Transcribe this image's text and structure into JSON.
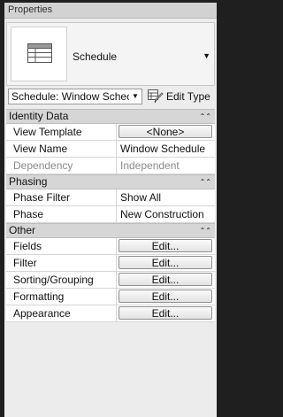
{
  "window": {
    "title": "Properties"
  },
  "type_selector": {
    "name": "Schedule",
    "icon": "schedule-icon"
  },
  "instance_selector": {
    "value": "Schedule: Window Schec"
  },
  "edit_type": {
    "label": "Edit Type"
  },
  "sections": {
    "identity": {
      "title": "Identity Data",
      "view_template": {
        "label": "View Template",
        "value": "<None>"
      },
      "view_name": {
        "label": "View Name",
        "value": "Window Schedule"
      },
      "dependency": {
        "label": "Dependency",
        "value": "Independent"
      }
    },
    "phasing": {
      "title": "Phasing",
      "phase_filter": {
        "label": "Phase Filter",
        "value": "Show All"
      },
      "phase": {
        "label": "Phase",
        "value": "New Construction"
      }
    },
    "other": {
      "title": "Other",
      "fields": {
        "label": "Fields",
        "value": "Edit..."
      },
      "filter": {
        "label": "Filter",
        "value": "Edit..."
      },
      "sorting": {
        "label": "Sorting/Grouping",
        "value": "Edit..."
      },
      "formatting": {
        "label": "Formatting",
        "value": "Edit..."
      },
      "appearance": {
        "label": "Appearance",
        "value": "Edit..."
      }
    }
  }
}
